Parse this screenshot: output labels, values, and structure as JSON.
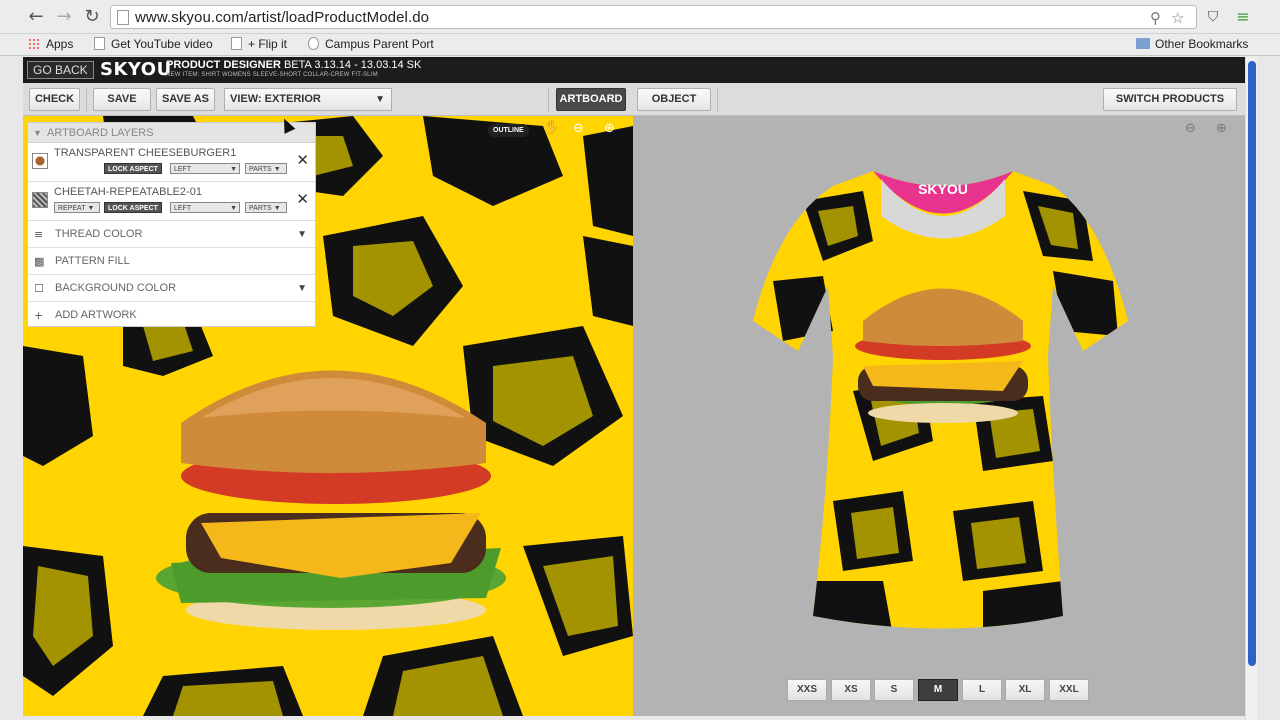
{
  "browser": {
    "url": "www.skyou.com/artist/loadProductModel.do",
    "bookmarks": [
      "Apps",
      "Get YouTube video",
      "+ Flip it",
      "Campus Parent Port"
    ],
    "other_bookmarks": "Other Bookmarks"
  },
  "header": {
    "go_back": "GO BACK",
    "logo": "SKYOU",
    "title_bold": "PRODUCT DESIGNER",
    "title_rest": " BETA 3.13.14 - 13.03.14 SK",
    "subtitle": "NEW ITEM: SHIRT WOMENS SLEEVE-SHORT COLLAR-CREW FIT-SLIM"
  },
  "toolbar": {
    "check": "CHECK",
    "save": "SAVE",
    "save_as": "SAVE AS",
    "view": "VIEW: EXTERIOR",
    "artboard": "ARTBOARD",
    "object": "OBJECT",
    "switch_products": "SWITCH PRODUCTS"
  },
  "layers_panel": {
    "header": "ARTBOARD LAYERS",
    "layers": [
      {
        "name": "TRANSPARENT CHEESEBURGER1",
        "chips": [
          "LOCK ASPECT",
          "LEFT",
          "PARTS"
        ]
      },
      {
        "name": "CHEETAH-REPEATABLE2-01",
        "chips": [
          "REPEAT",
          "LOCK ASPECT",
          "LEFT",
          "PARTS"
        ]
      }
    ],
    "options": {
      "thread_color": "THREAD COLOR",
      "pattern_fill": "PATTERN FILL",
      "background_color": "BACKGROUND COLOR",
      "add_artwork": "ADD ARTWORK"
    }
  },
  "artboard": {
    "outline": "OUTLINE"
  },
  "preview": {
    "neck_label": "SKYOU"
  },
  "sizes": {
    "options": [
      "XXS",
      "XS",
      "S",
      "M",
      "L",
      "XL",
      "XXL"
    ],
    "selected": "M"
  },
  "colors": {
    "pattern_yellow": "#ffd400",
    "pattern_black": "#111111",
    "pattern_olive": "#a39300",
    "neck_pink": "#e8338f"
  }
}
